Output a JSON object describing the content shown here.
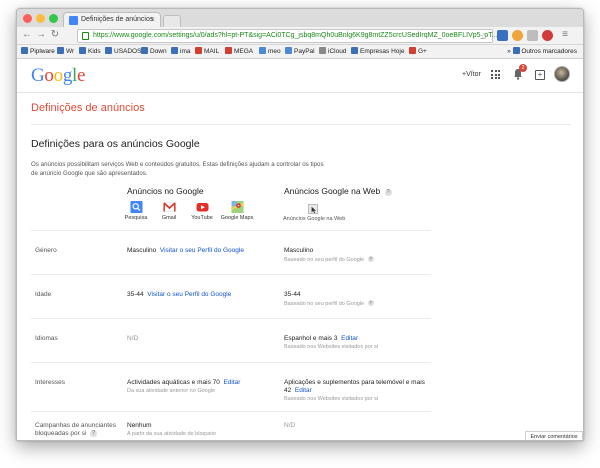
{
  "browser": {
    "tab_title": "Definições de anúncios",
    "url": "https://www.google.com/settings/u/0/ads?hl=pt-PT&sig=ACi0TCg_jsbq8mQh0uBnlg6K9g8mtZZ5crcUSedIrqMZ_0oeBFLIVp5_oT...",
    "bookmarks": [
      "Piplware",
      "Wr",
      "Kids",
      "USADOS",
      "Down",
      "ima",
      "MAIL",
      "MEGA",
      "meo",
      "PayPal",
      "iCloud",
      "Empresas Hoje",
      "G+"
    ],
    "other_bookmarks": "Outros marcadores"
  },
  "header": {
    "logo": "Google",
    "plus_user": "+Vítor",
    "notification_count": "2"
  },
  "page": {
    "title": "Definições de anúncios",
    "section_title": "Definições para os anúncios Google",
    "description": "Os anúncios possibilitam serviços Web e conteúdos gratuitos. Estas definições ajudam a controlar os tipos de anúncio Google que são apresentados."
  },
  "columns": {
    "google": "Anúncios no Google",
    "web": "Anúncios Google na Web",
    "help": "?"
  },
  "services": [
    "Pesquisa",
    "Gmail",
    "YouTube",
    "Google Maps"
  ],
  "web_icon_label": "Anúncios Google na Web",
  "rows": [
    {
      "label": "Género",
      "google_value": "Masculino",
      "google_link": "Visitar o seu Perfil do Google",
      "web_value": "Masculino",
      "web_sub": "Baseado no seu perfil do Google"
    },
    {
      "label": "Idade",
      "google_value": "35-44",
      "google_link": "Visitar o seu Perfil do Google",
      "web_value": "35-44",
      "web_sub": "Baseado no seu perfil do Google"
    },
    {
      "label": "Idiomas",
      "google_value": "N/D",
      "web_value": "Espanhol e mais 3",
      "web_link": "Editar",
      "web_sub": "Baseado nos Websites visitados por si"
    },
    {
      "label": "Interesses",
      "google_value": "Actividades aquáticas e mais 70",
      "google_link": "Editar",
      "google_sub": "Da sua atividade anterior no Google",
      "web_value": "Aplicações e suplementos para telemóvel e mais",
      "web_value2": "42",
      "web_link": "Editar",
      "web_sub": "Baseado nos Websites visitados por si"
    },
    {
      "label": "Campanhas de anunciantes",
      "label2": "bloqueadas por si",
      "google_value": "Nenhum",
      "google_sub": "A partir da sua atividade de bloqueio",
      "web_value": "N/D"
    }
  ],
  "feedback": "Enviar comentários",
  "colors": {
    "accent_red": "#dd4b39",
    "link_blue": "#1155cc",
    "url_green": "#1a8a1a"
  }
}
